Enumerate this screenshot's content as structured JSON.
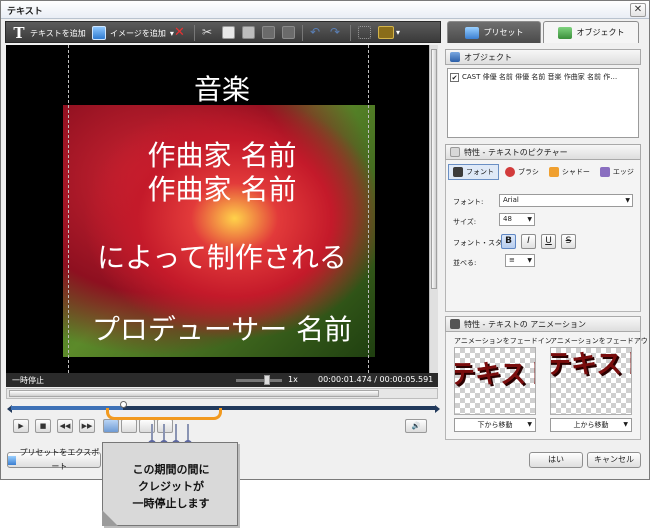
{
  "window": {
    "title": "テキスト",
    "close_glyph": "✕"
  },
  "toolbar": {
    "add_text_label": "テキストを追加",
    "add_image_label": "イメージを追加",
    "add_text_glyph": "T",
    "dropdown_glyph": "▾"
  },
  "tabs": [
    {
      "label": "プリセット",
      "active": false
    },
    {
      "label": "オブジェクト",
      "active": true
    }
  ],
  "preview": {
    "credit_lines": [
      "音楽",
      "作曲家 名前",
      "作曲家 名前",
      "によって制作される",
      "プロデューサー 名前"
    ]
  },
  "status": {
    "state": "一時停止",
    "speed": "1x",
    "time": "00:00:01.474 / 00:00:05.591"
  },
  "timeline": {
    "position_fraction": 0.2636
  },
  "playback": {
    "play": "▶",
    "stop": "■",
    "prev": "◀◀",
    "next": "▶▶",
    "volume": "🔊"
  },
  "objects_panel": {
    "header": "オブジェクト",
    "items": [
      {
        "checked": true,
        "text": "CAST 俳優 名前 俳優 名前 音楽 作曲家 名前 作…"
      }
    ]
  },
  "properties_panel": {
    "header": "特性 - テキストのピクチャー",
    "tabs": [
      "フォント",
      "ブラシ",
      "シャドー",
      "エッジ"
    ],
    "font_label": "フォント:",
    "font_value": "Arial",
    "size_label": "サイズ:",
    "size_value": "48",
    "style_label": "フォント・スタイル",
    "style_buttons": [
      "B",
      "I",
      "U",
      "S"
    ],
    "align_label": "並べる:",
    "align_value": "≡"
  },
  "animation_panel": {
    "header": "特性 - テキストの アニメーション",
    "fade_in_label": "アニメーションをフェードイン",
    "fade_out_label": "アニメーションをフェードアウト",
    "preview_text": "テキスト",
    "fade_in_value": "下から移動",
    "fade_out_value": "上から移動"
  },
  "buttons": {
    "export_preset": "プリセットをエクスポート",
    "ok": "はい",
    "cancel": "キャンセル"
  },
  "callout": {
    "lines": [
      "この期間の間に",
      "クレジットが",
      "一時停止します"
    ]
  },
  "colors": {
    "accent_orange": "#f29a1f",
    "timeline_fill": "#3e71b6",
    "credit_text": "#ffffff"
  }
}
